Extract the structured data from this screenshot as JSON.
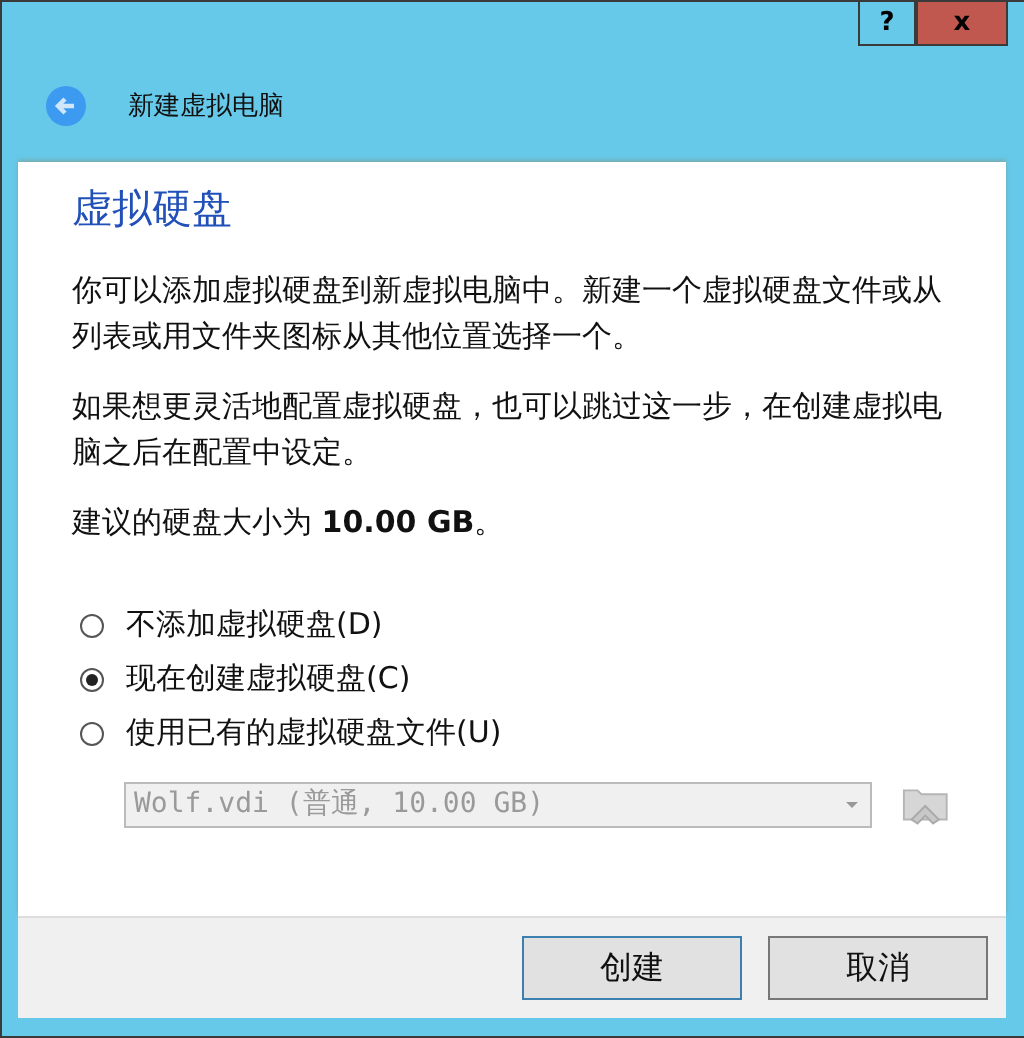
{
  "window": {
    "help_button": "?",
    "close_button": "x",
    "title": "新建虚拟电脑"
  },
  "page": {
    "heading": "虚拟硬盘",
    "paragraphs": [
      "你可以添加虚拟硬盘到新虚拟电脑中。新建一个虚拟硬盘文件或从列表或用文件夹图标从其他位置选择一个。",
      "如果想更灵活地配置虚拟硬盘，也可以跳过这一步，在创建虚拟电脑之后在配置中设定。",
      "建议的硬盘大小为 **10.00 GB**。"
    ],
    "options": [
      {
        "label": "不添加虚拟硬盘(D)",
        "selected": false
      },
      {
        "label": "现在创建虚拟硬盘(C)",
        "selected": true
      },
      {
        "label": "使用已有的虚拟硬盘文件(U)",
        "selected": false
      }
    ],
    "file_select": {
      "value": "Wolf.vdi (普通, 10.00 GB)",
      "disabled": true
    }
  },
  "buttons": [
    {
      "label": "创建",
      "default": true
    },
    {
      "label": "取消",
      "default": false
    }
  ]
}
